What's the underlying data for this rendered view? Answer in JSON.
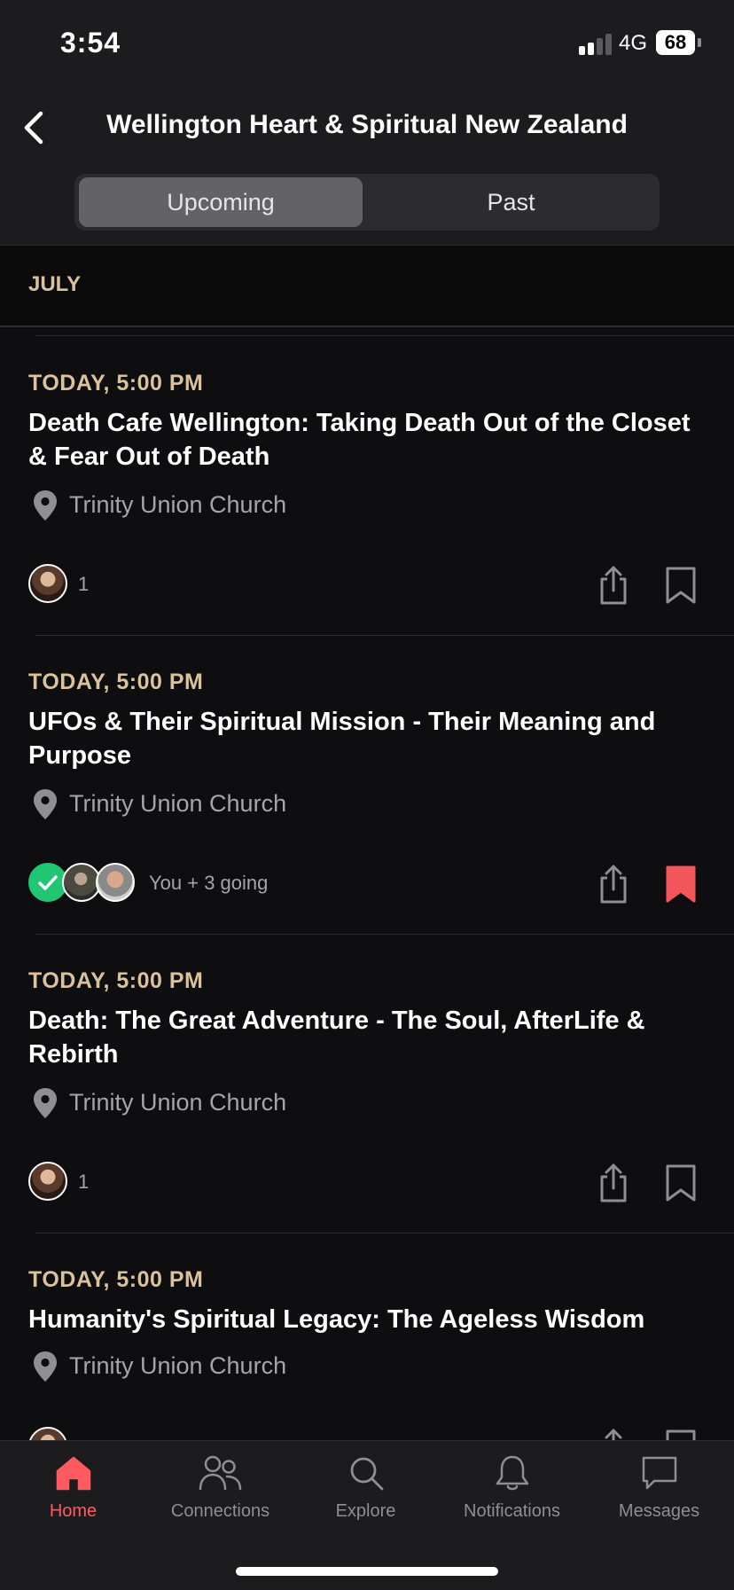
{
  "status_bar": {
    "time": "3:54",
    "network": "4G",
    "battery": "68"
  },
  "header": {
    "title": "Wellington Heart & Spiritual New Zealand"
  },
  "segments": {
    "upcoming": "Upcoming",
    "past": "Past"
  },
  "month_label": "JULY",
  "events": [
    {
      "date": "TODAY, 5:00 PM",
      "title": "Death Cafe Wellington: Taking Death Out of the Closet & Fear Out of Death",
      "location": "Trinity Union Church",
      "attendee_text": "1",
      "bookmarked": false
    },
    {
      "date": "TODAY, 5:00 PM",
      "title": "UFOs & Their Spiritual Mission - Their Meaning and Purpose",
      "location": "Trinity Union Church",
      "attendee_text": "You + 3 going",
      "bookmarked": true
    },
    {
      "date": "TODAY, 5:00 PM",
      "title": "Death: The Great Adventure - The Soul, AfterLife & Rebirth",
      "location": "Trinity Union Church",
      "attendee_text": "1",
      "bookmarked": false
    },
    {
      "date": "TODAY, 5:00 PM",
      "title": "Humanity's Spiritual Legacy: The Ageless Wisdom",
      "location": "Trinity Union Church",
      "attendee_text": "",
      "bookmarked": false
    }
  ],
  "tabbar": {
    "home": "Home",
    "connections": "Connections",
    "explore": "Explore",
    "notifications": "Notifications",
    "messages": "Messages"
  },
  "icons": {
    "back": "chevron-left-icon",
    "pin": "map-pin-icon",
    "share": "share-icon",
    "bookmark": "bookmark-icon",
    "check": "check-icon",
    "home": "home-icon",
    "connections": "people-icon",
    "explore": "search-icon",
    "notifications": "bell-icon",
    "messages": "chat-bubble-icon"
  },
  "colors": {
    "background": "#0e0e10",
    "bar": "#1c1c1e",
    "date_accent": "#d9c29c",
    "active_tab": "#ff5a5f",
    "bookmark_active": "#f2555a",
    "going_check": "#20c671"
  }
}
